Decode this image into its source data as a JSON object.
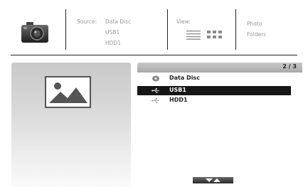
{
  "header": {
    "source": {
      "label": "Source:",
      "options": [
        "Data Disc",
        "USB1",
        "HDD1"
      ]
    },
    "view": {
      "label": "View:",
      "modes": [
        "list-view-icon",
        "grid-view-icon"
      ]
    },
    "content_type": {
      "options": [
        "Photo",
        "Folders"
      ]
    }
  },
  "list": {
    "page_indicator": "2 / 3",
    "items": [
      {
        "label": "Data Disc",
        "icon": "disc-icon",
        "selected": false
      },
      {
        "label": "USB1",
        "icon": "usb-icon",
        "selected": true
      },
      {
        "label": "HDD1",
        "icon": "hdd-icon",
        "selected": false
      }
    ]
  },
  "colors": {
    "selection_bg": "#161616",
    "selection_text": "#ffffff",
    "muted_text": "#9a9a9a"
  }
}
